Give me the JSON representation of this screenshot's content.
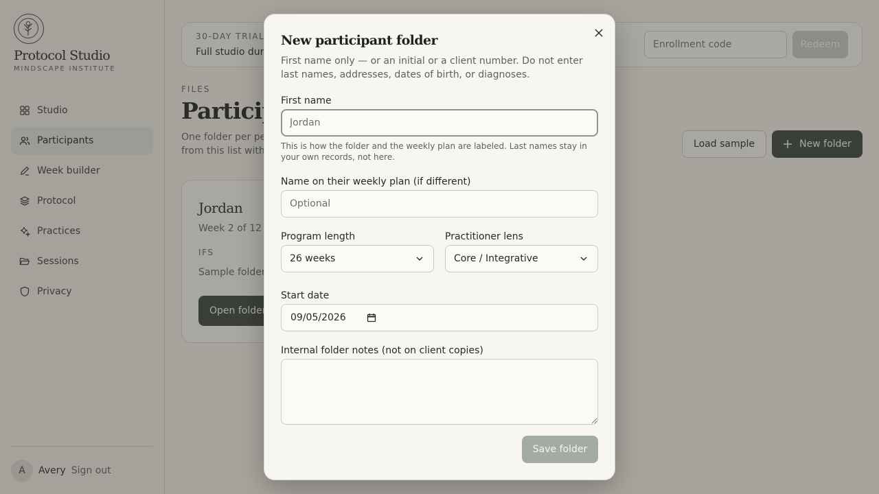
{
  "sidebar": {
    "brand_title": "Protocol Studio",
    "brand_subtitle": "MINDSCAPE INSTITUTE",
    "nav": [
      {
        "label": "Studio",
        "icon": "grid-icon"
      },
      {
        "label": "Participants",
        "icon": "users-icon",
        "active": true
      },
      {
        "label": "Week builder",
        "icon": "pencil-icon"
      },
      {
        "label": "Protocol",
        "icon": "layers-icon"
      },
      {
        "label": "Practices",
        "icon": "sparkle-icon"
      },
      {
        "label": "Sessions",
        "icon": "folder-open-icon"
      },
      {
        "label": "Privacy",
        "icon": "shield-icon"
      }
    ],
    "user": {
      "initial": "A",
      "name": "Avery",
      "sign_out": "Sign out"
    }
  },
  "trial": {
    "kicker": "30-DAY TRIAL",
    "text": "Full studio dur",
    "enrollment_placeholder": "Enrollment code",
    "redeem_label": "Redeem"
  },
  "main": {
    "kicker": "FILES",
    "title": "Participa",
    "description_line1": "One folder per pe",
    "description_line2": "from this list with",
    "load_sample_label": "Load sample",
    "new_folder_label": "New folder"
  },
  "card": {
    "name": "Jordan",
    "week": "Week 2 of 12",
    "lens": "IFS",
    "note": "Sample folder",
    "open_label": "Open folder"
  },
  "modal": {
    "title": "New participant folder",
    "intro": "First name only — or an initial or a client number. Do not enter last names, addresses, dates of birth, or diagnoses.",
    "first_name_label": "First name",
    "first_name_placeholder": "Jordan",
    "first_name_help": "This is how the folder and the weekly plan are labeled. Last names stay in your own records, not here.",
    "plan_name_label": "Name on their weekly plan (if different)",
    "plan_name_placeholder": "Optional",
    "program_length_label": "Program length",
    "program_length_value": "26 weeks",
    "lens_label": "Practitioner lens",
    "lens_value": "Core / Integrative",
    "start_date_label": "Start date",
    "start_date_value": "09/05/2026",
    "notes_label": "Internal folder notes (not on client copies)",
    "save_label": "Save folder"
  }
}
